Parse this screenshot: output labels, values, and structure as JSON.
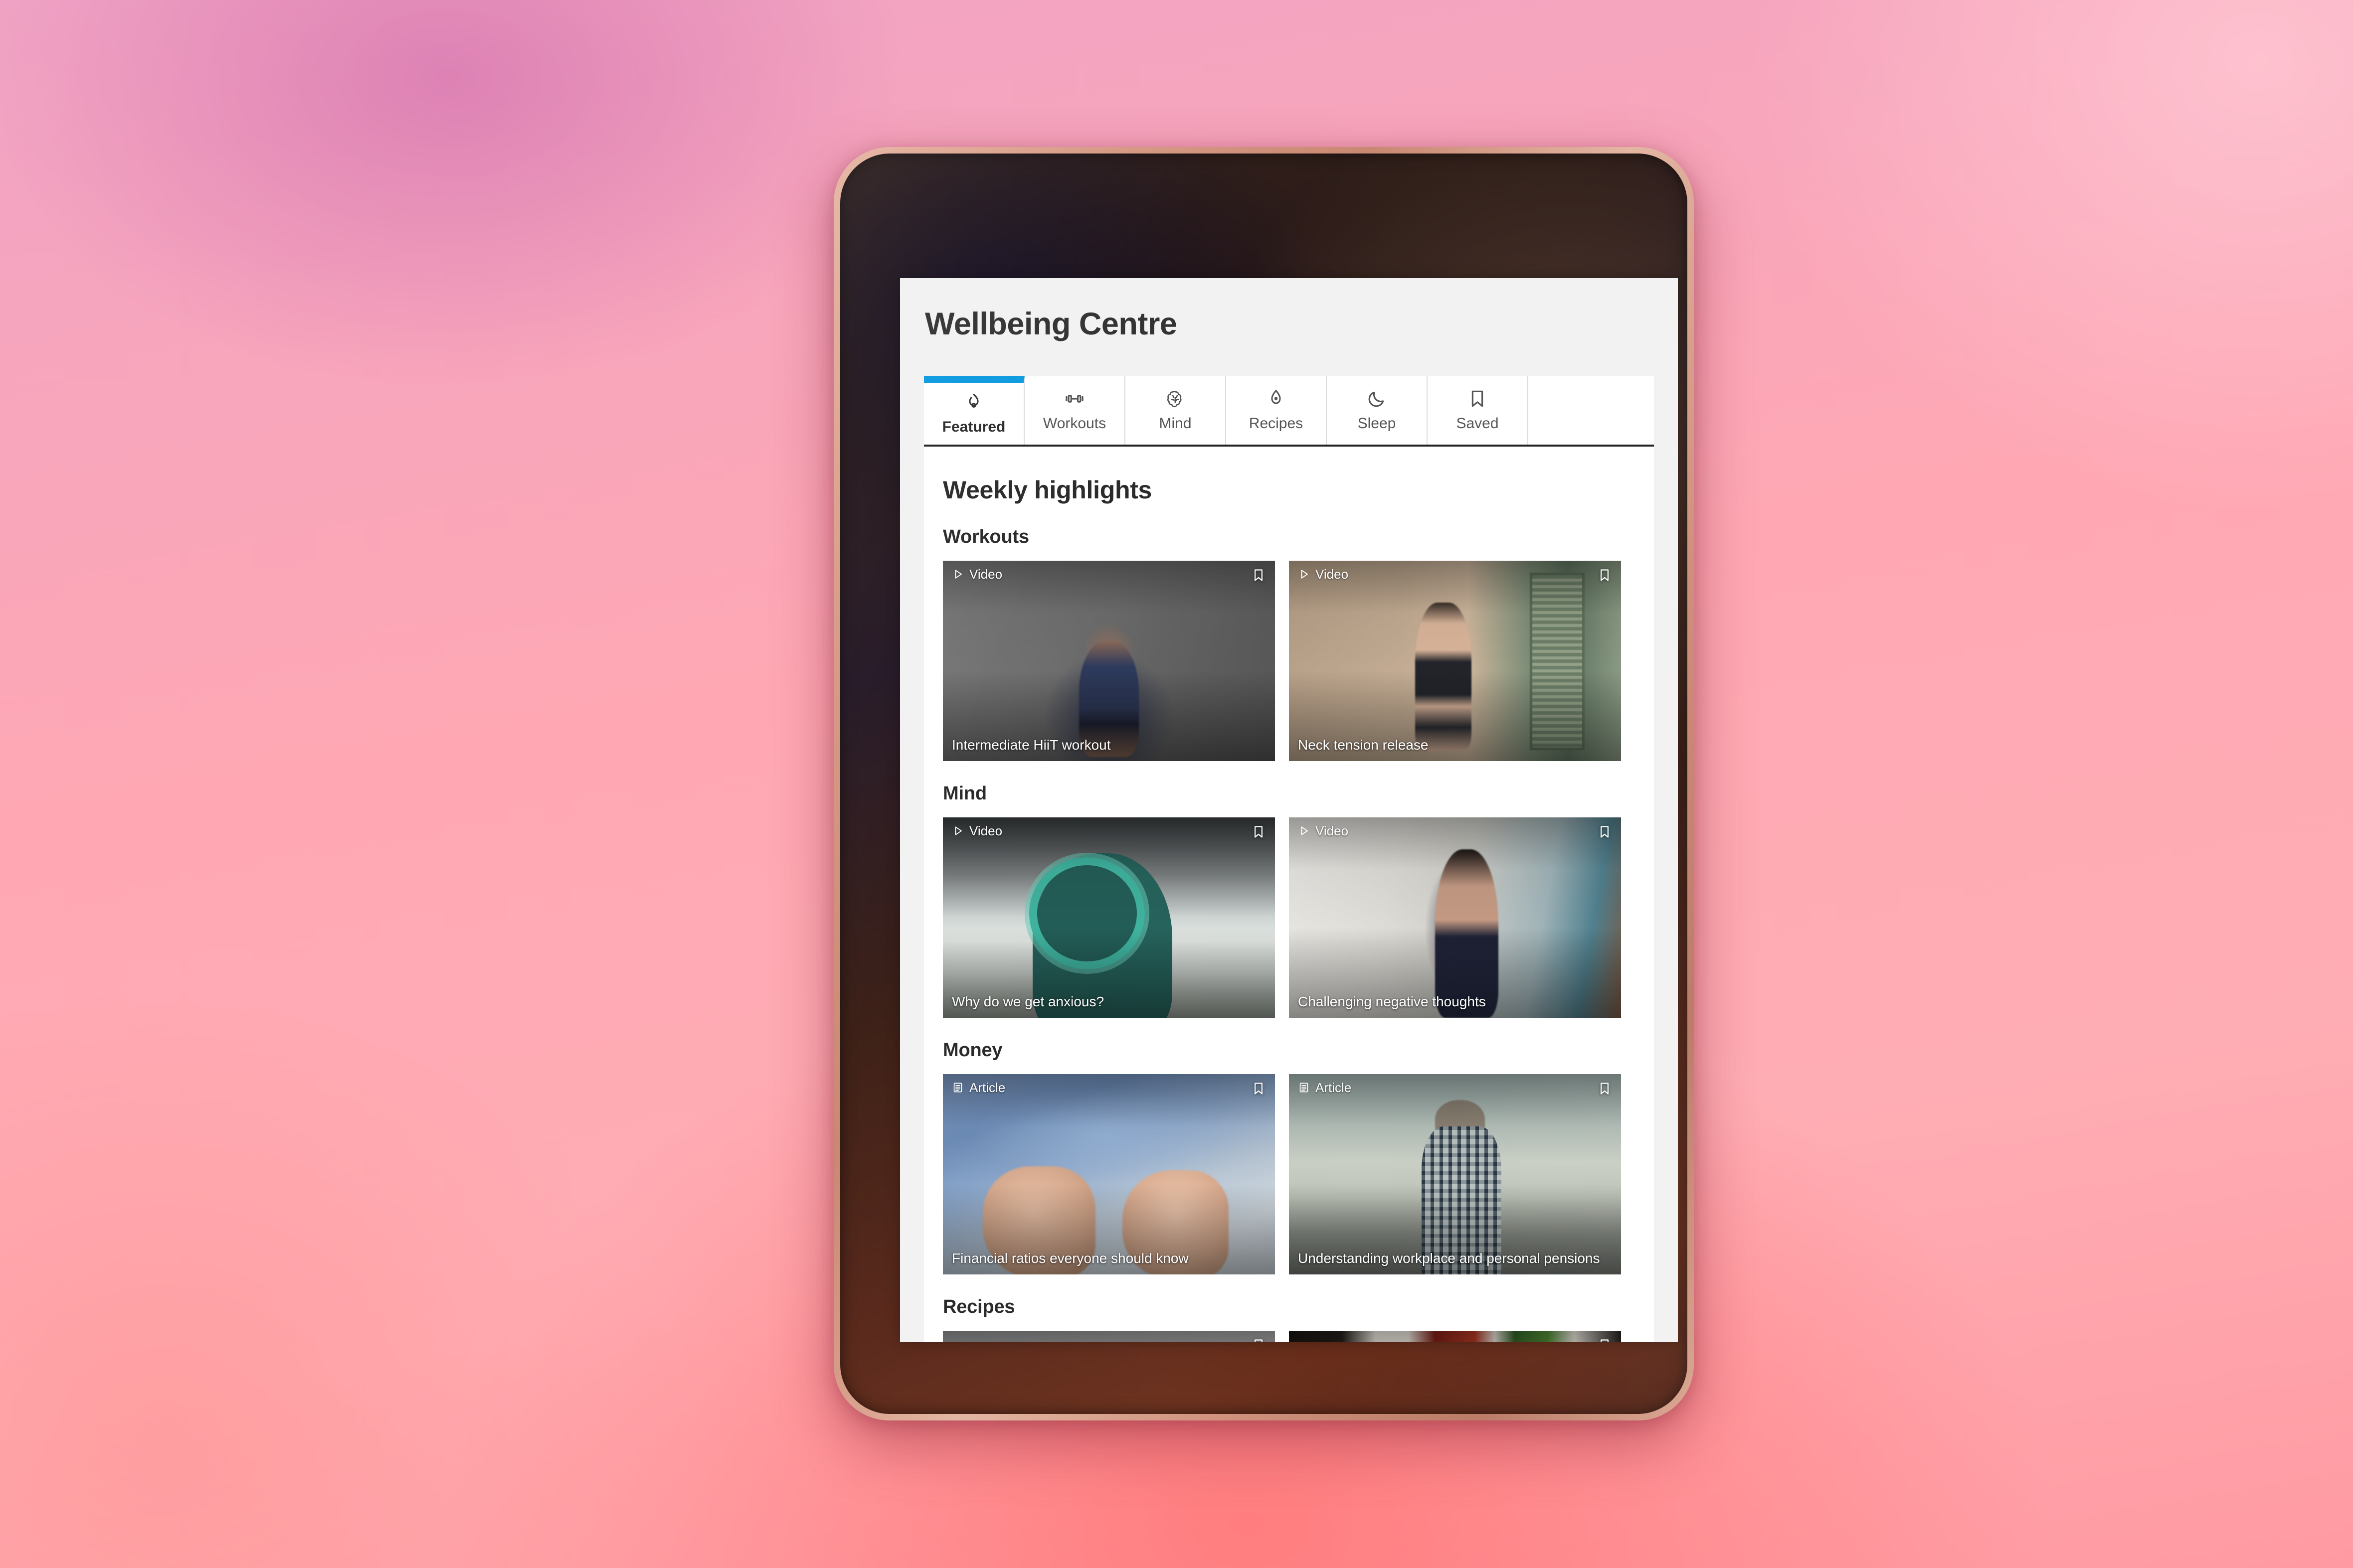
{
  "app": {
    "title": "Wellbeing Centre"
  },
  "tabs": [
    {
      "label": "Featured",
      "icon": "flame-icon",
      "active": true
    },
    {
      "label": "Workouts",
      "icon": "dumbbell-icon",
      "active": false
    },
    {
      "label": "Mind",
      "icon": "brain-icon",
      "active": false
    },
    {
      "label": "Recipes",
      "icon": "avocado-icon",
      "active": false
    },
    {
      "label": "Sleep",
      "icon": "moon-icon",
      "active": false
    },
    {
      "label": "Saved",
      "icon": "bookmark-icon",
      "active": false
    }
  ],
  "main": {
    "heading": "Weekly highlights",
    "sections": [
      {
        "title": "Workouts",
        "cards": [
          {
            "type": "Video",
            "type_icon": "play-icon",
            "title": "Intermediate HiiT workout",
            "bookmark_icon": "bookmark-icon"
          },
          {
            "type": "Video",
            "type_icon": "play-icon",
            "title": "Neck tension release",
            "bookmark_icon": "bookmark-icon"
          }
        ]
      },
      {
        "title": "Mind",
        "cards": [
          {
            "type": "Video",
            "type_icon": "play-icon",
            "title": "Why do we get anxious?",
            "bookmark_icon": "bookmark-icon"
          },
          {
            "type": "Video",
            "type_icon": "play-icon",
            "title": "Challenging negative thoughts",
            "bookmark_icon": "bookmark-icon"
          }
        ]
      },
      {
        "title": "Money",
        "cards": [
          {
            "type": "Article",
            "type_icon": "document-icon",
            "title": "Financial ratios everyone should know",
            "bookmark_icon": "bookmark-icon"
          },
          {
            "type": "Article",
            "type_icon": "document-icon",
            "title": "Understanding workplace and personal pensions",
            "bookmark_icon": "bookmark-icon"
          }
        ]
      },
      {
        "title": "Recipes",
        "cards": [
          {
            "type": "",
            "type_icon": "",
            "title": "",
            "bookmark_icon": "bookmark-icon"
          },
          {
            "type": "",
            "type_icon": "",
            "title": "",
            "bookmark_icon": "bookmark-icon"
          }
        ]
      }
    ]
  },
  "colors": {
    "accent": "#0e9ae0",
    "page_bg": "#f2f2f2",
    "panel_bg": "#ffffff",
    "text": "#2b2b2b",
    "tab_inactive_text": "#555555",
    "backdrop_pink": "#ffa8b4",
    "tablet_bezel": "#cf917c"
  },
  "device": {
    "home_button": "home-button"
  }
}
